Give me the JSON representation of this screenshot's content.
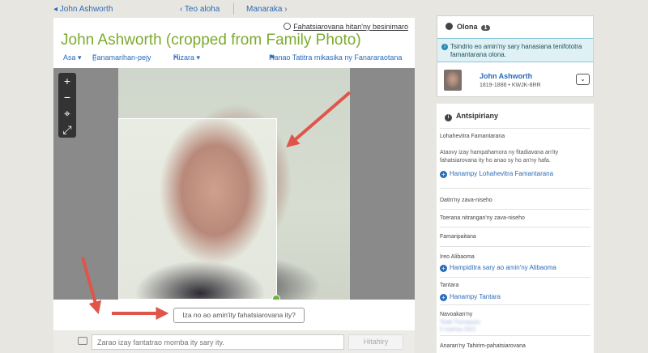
{
  "topbar": {
    "back_label": "◂ John Ashworth",
    "prev_label": "‹ Teo aloha",
    "next_label": "Manaraka ›"
  },
  "header": {
    "privacy_label": "Fahatsiarovana hitan'ny besinimaro",
    "title": "John Ashworth (cropped from Family Photo)"
  },
  "actions": {
    "view_label": "Asa ▾",
    "attach_label": "Fanamarihan-pejy",
    "share_label": "Hizara ▾",
    "report_label": "Hanao Tatitra mikasika ny Fanararaotana"
  },
  "zoom": {
    "in_label": "+",
    "out_label": "−",
    "center_label": "⌖",
    "fullscreen_label": "⤢"
  },
  "caption_placeholder": "Iza no ao amin'ity fahatsiarovana ity?",
  "comment": {
    "placeholder": "Zarao izay fantatrao momba ity sary ity.",
    "button_label": "Hitahiry"
  },
  "sidebar": {
    "people_title": "Olona",
    "people_count": "1",
    "info_text": "Tsindrio eo amin'ny sary hanasiana tenifototra famantarana olona.",
    "person_name": "John Ashworth",
    "person_dates": "1819-1886 • KWJK-8RR",
    "details_title": "Antsipiriany",
    "description_label": "Lohahevitra Famantarana",
    "description_text": "Ataovy izay hampahamora ny fitadiavana an'ity fahatsiarovana ity ho anao sy ho an'ny hafa.",
    "description_link": "Hanampy Lohahevitra Famantarana",
    "date_label": "Datin'ny zava-niseho",
    "place_label": "Toerana nitrangan'ny zava-niseho",
    "copyright_label": "Famaripaitana",
    "album_label": "Ireo Alibaoma",
    "album_link": "Hampiditra sary ao amin'ny Alibaoma",
    "tags_label": "Tantara",
    "tags_link": "Hanampy Tantara",
    "contributor_label": "Navoakan'ny",
    "contributor_value": "Todd Thompson",
    "contributor_date": "5 martsa 2021",
    "filename_label": "Anaran'ny Tahirim-pahatsiarovana"
  }
}
